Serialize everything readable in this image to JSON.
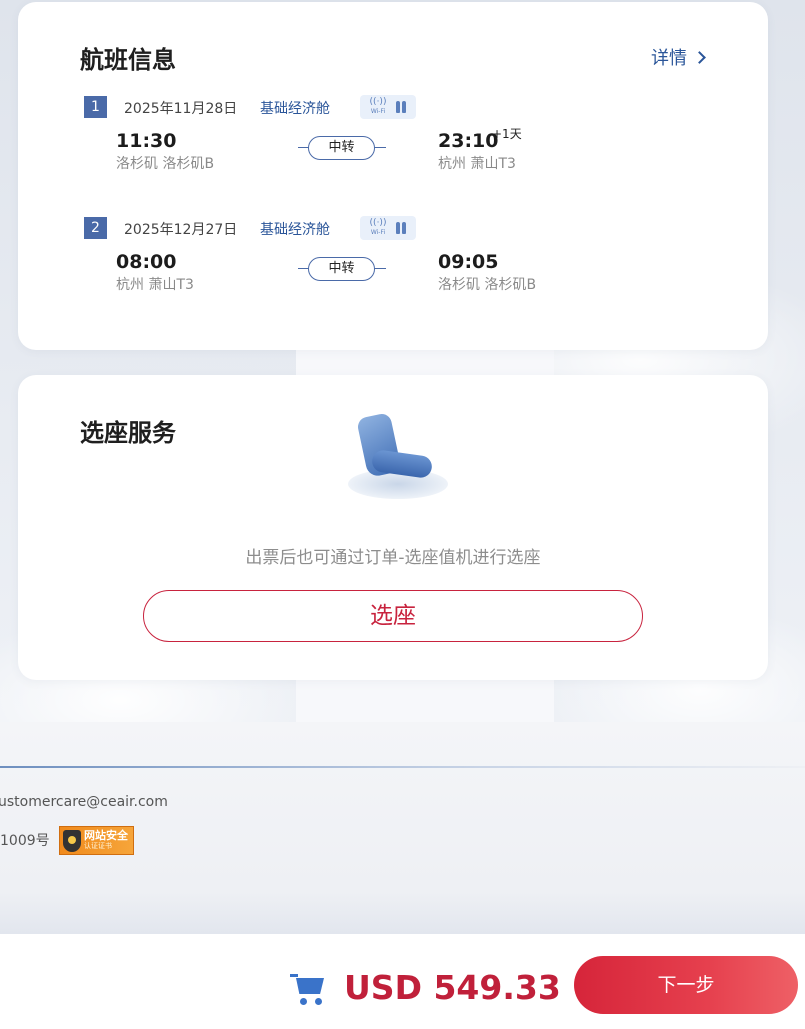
{
  "flight_card": {
    "title": "航班信息",
    "detail_link": "详情",
    "segments": [
      {
        "index": "1",
        "date": "2025年11月28日",
        "cabin": "基础经济舱",
        "amenities": [
          "wifi-icon",
          "meal-icon"
        ],
        "wifi_label": "Wi-Fi",
        "departure_time": "11:30",
        "departure_airport": "洛杉矶 洛杉矶B",
        "transfer_label": "中转",
        "arrival_time": "23:10",
        "arrival_day_offset": "+1天",
        "arrival_airport": "杭州 萧山T3"
      },
      {
        "index": "2",
        "date": "2025年12月27日",
        "cabin": "基础经济舱",
        "amenities": [
          "wifi-icon",
          "meal-icon"
        ],
        "wifi_label": "Wi-Fi",
        "departure_time": "08:00",
        "departure_airport": "杭州 萧山T3",
        "transfer_label": "中转",
        "arrival_time": "09:05",
        "arrival_day_offset": "",
        "arrival_airport": "洛杉矶 洛杉矶B"
      }
    ]
  },
  "seat_card": {
    "title": "选座服务",
    "hint": "出票后也可通过订单-选座值机进行选座",
    "button_label": "选座"
  },
  "footer": {
    "email": "ustomercare@ceair.com",
    "icp": "1009号",
    "badge_line1": "网站安全",
    "badge_line2": "认证证书"
  },
  "bottom_bar": {
    "price": "USD 549.33",
    "next_label": "下一步"
  },
  "colors": {
    "accent_blue": "#2a5599",
    "brand_red": "#c0203a"
  }
}
